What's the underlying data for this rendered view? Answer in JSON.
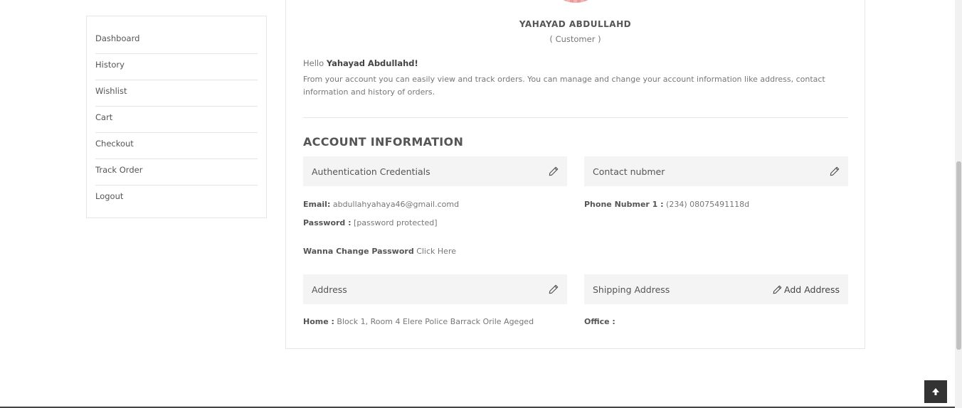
{
  "sidebar": {
    "items": [
      {
        "label": "Dashboard"
      },
      {
        "label": "History"
      },
      {
        "label": "Wishlist"
      },
      {
        "label": "Cart"
      },
      {
        "label": "Checkout"
      },
      {
        "label": "Track Order"
      },
      {
        "label": "Logout"
      }
    ]
  },
  "profile": {
    "name": "YAHAYAD ABDULLAHD",
    "role": "( Customer )"
  },
  "greeting": {
    "hello": "Hello ",
    "name": "Yahayad Abdullahd!",
    "intro": "From your account you can easily view and track orders. You can manage and change your account information like address, contact information and history of orders."
  },
  "account": {
    "section_title": "ACCOUNT INFORMATION",
    "auth": {
      "title": "Authentication Credentials",
      "email_label": "Email:",
      "email_value": " abdullahyahaya46@gmail.comd",
      "password_label": "Password :",
      "password_value": " [password protected]",
      "change_label": "Wanna Change Password",
      "change_link": " Click Here"
    },
    "contact": {
      "title": "Contact nubmer",
      "phone_label": "Phone Nubmer 1 :",
      "phone_value": " (234) 08075491118d"
    },
    "address": {
      "title": "Address",
      "home_label": "Home :",
      "home_value": " Block 1, Room 4 Elere Police Barrack Orile Ageged"
    },
    "shipping": {
      "title": "Shipping Address",
      "add_label": "Add Address",
      "office_label": "Office :"
    }
  },
  "icons": {
    "edit": "pencil-icon",
    "scroll_top": "arrow-up-icon"
  }
}
